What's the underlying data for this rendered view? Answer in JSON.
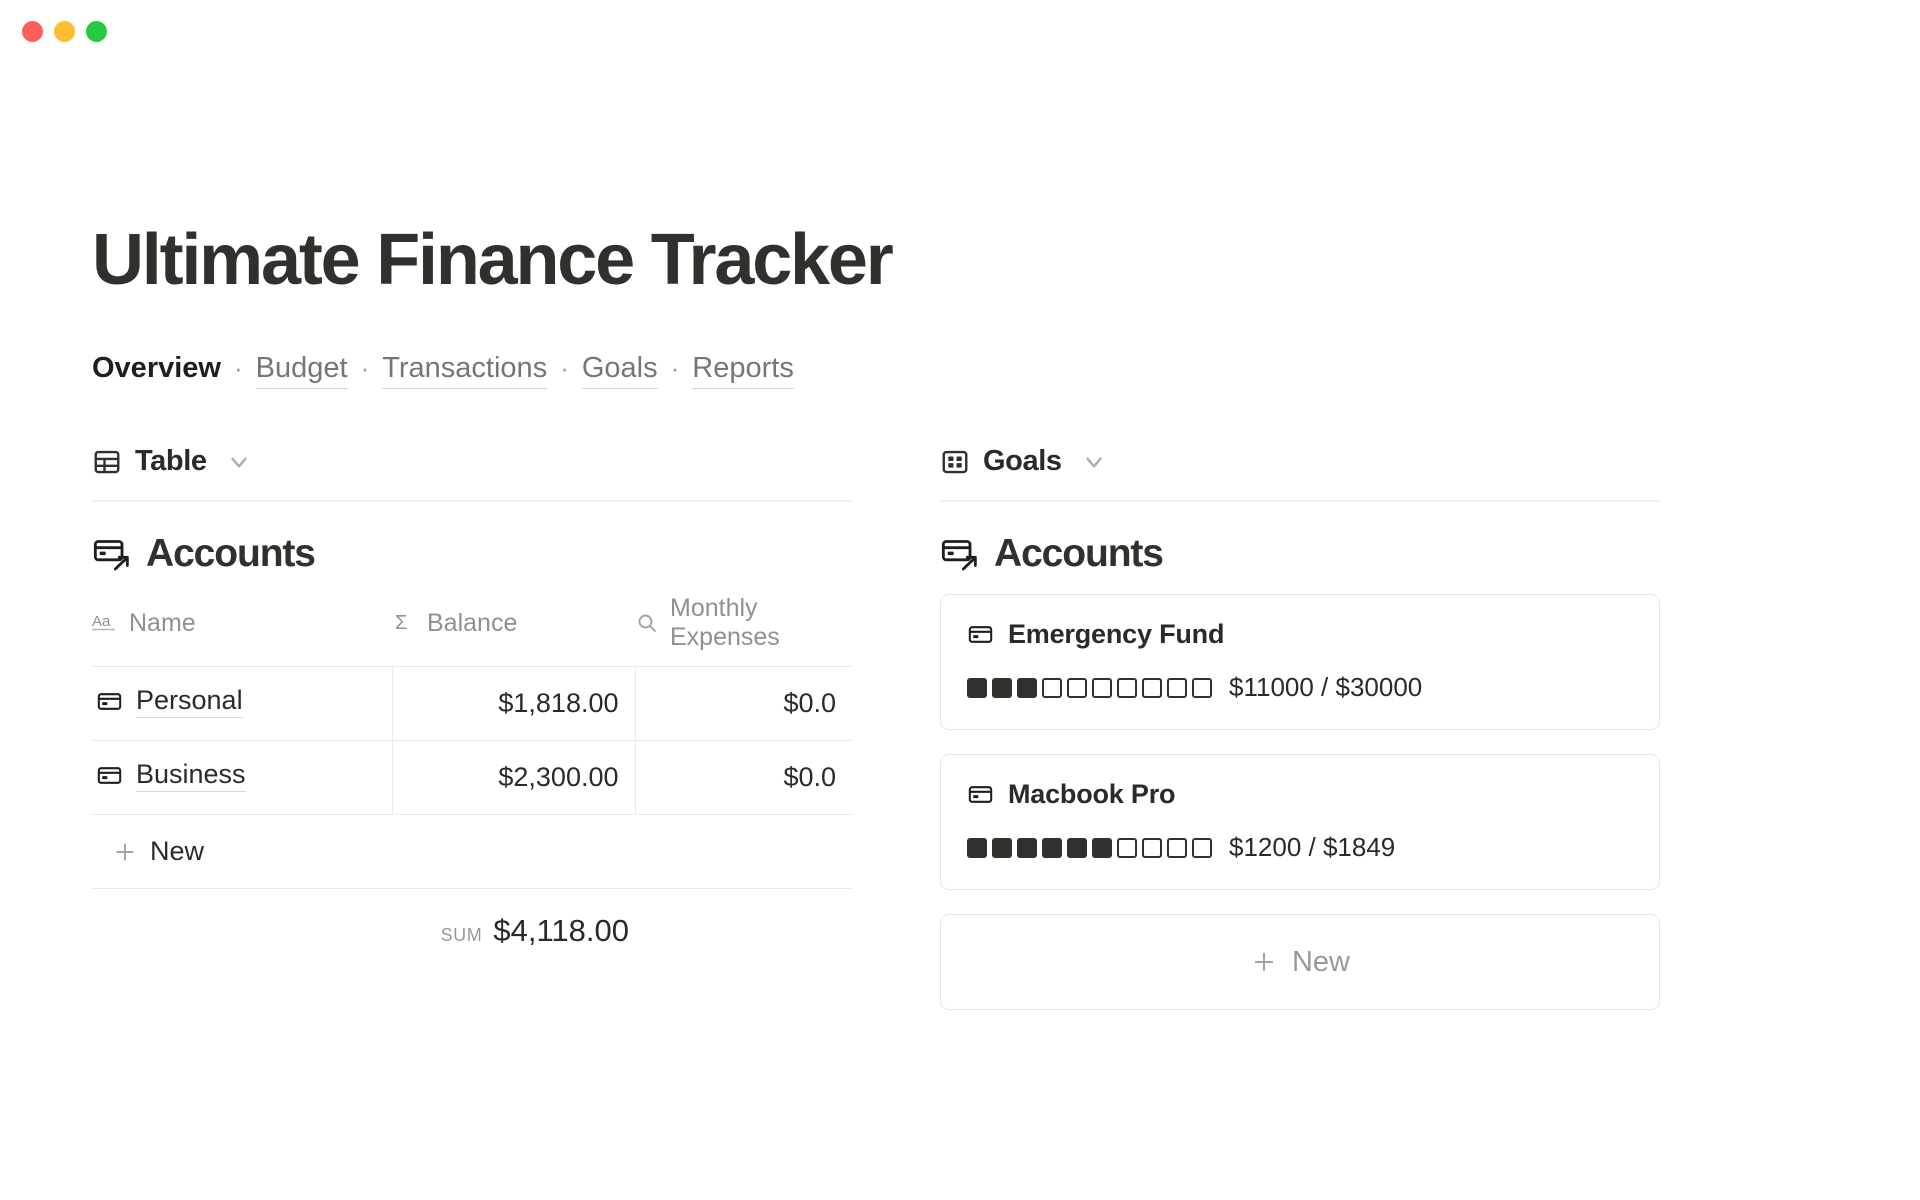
{
  "window": {
    "traffic_lights": [
      {
        "name": "close",
        "color": "#ff5f57"
      },
      {
        "name": "minimize",
        "color": "#febc2e"
      },
      {
        "name": "maximize",
        "color": "#28c840"
      }
    ]
  },
  "header": {
    "title": "Ultimate Finance Tracker"
  },
  "nav": {
    "separator": "·",
    "items": [
      {
        "label": "Overview",
        "current": true
      },
      {
        "label": "Budget",
        "current": false
      },
      {
        "label": "Transactions",
        "current": false
      },
      {
        "label": "Goals",
        "current": false
      },
      {
        "label": "Reports",
        "current": false
      }
    ]
  },
  "left_panel": {
    "view": {
      "label": "Table",
      "icon": "table-icon",
      "chevron": "chevron-down-icon"
    },
    "database": {
      "title": "Accounts",
      "icon": "card-link-icon",
      "columns": [
        {
          "label": "Name",
          "icon": "aa-text-icon",
          "align": "left"
        },
        {
          "label": "Balance",
          "icon": "sigma-icon",
          "align": "right"
        },
        {
          "label": "Monthly Expenses",
          "icon": "search-icon",
          "align": "right"
        }
      ],
      "rows": [
        {
          "icon": "card-icon",
          "name": "Personal",
          "balance": "$1,818.00",
          "monthly_expenses": "$0.0"
        },
        {
          "icon": "card-icon",
          "name": "Business",
          "balance": "$2,300.00",
          "monthly_expenses": "$0.0"
        }
      ],
      "new_row_label": "New",
      "summary": {
        "label": "SUM",
        "value": "$4,118.00"
      }
    }
  },
  "right_panel": {
    "view": {
      "label": "Goals",
      "icon": "gallery-icon",
      "chevron": "chevron-down-icon"
    },
    "database": {
      "title": "Accounts",
      "icon": "card-link-icon",
      "cards": [
        {
          "icon": "card-icon",
          "title": "Emergency Fund",
          "pips_total": 10,
          "pips_filled": 3,
          "progress_text": "$11000 / $30000",
          "current": 11000,
          "target": 30000
        },
        {
          "icon": "card-icon",
          "title": "Macbook Pro",
          "pips_total": 10,
          "pips_filled": 6,
          "progress_text": "$1200 / $1849",
          "current": 1200,
          "target": 1849
        }
      ],
      "new_card_label": "New"
    }
  },
  "colors": {
    "text_primary": "#2c2a27",
    "text_muted": "#90908c",
    "border": "#eceae8",
    "accent": "#33312e"
  }
}
